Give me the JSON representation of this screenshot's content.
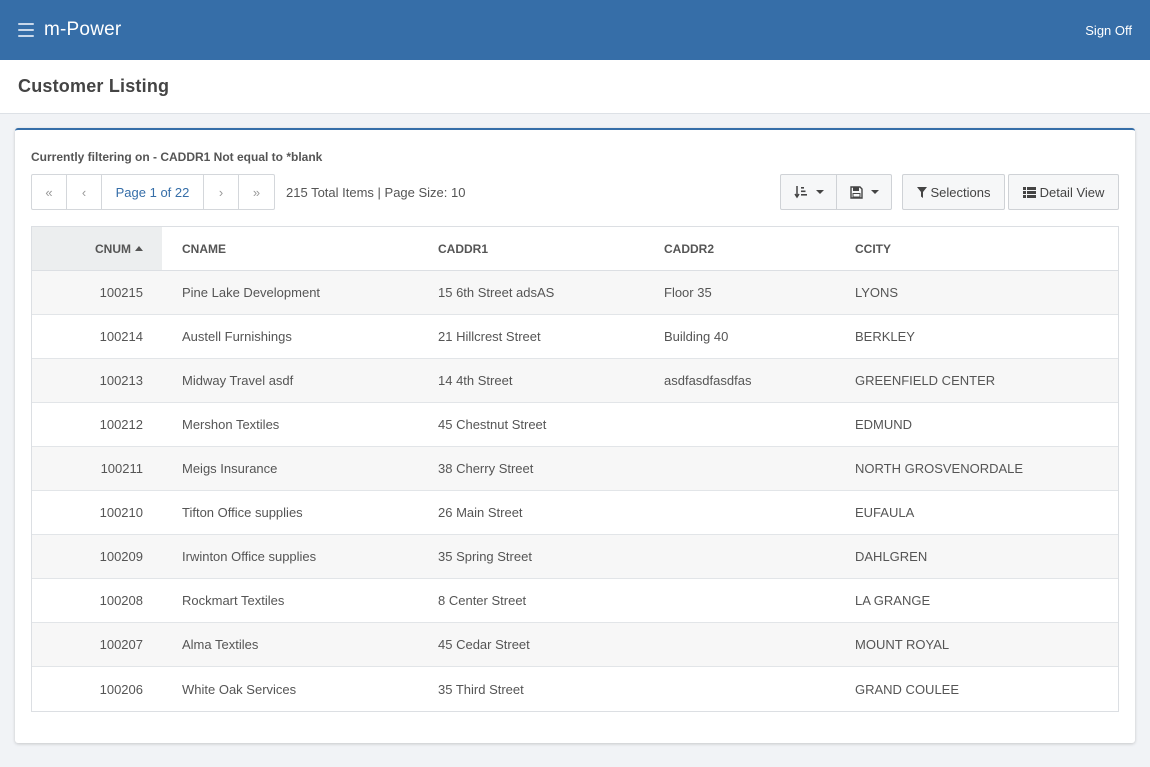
{
  "app": {
    "title": "m-Power",
    "sign_off": "Sign Off"
  },
  "page": {
    "title": "Customer Listing"
  },
  "filter_note": "Currently filtering on - CADDR1 Not equal to *blank",
  "pager": {
    "first": "«",
    "prev": "‹",
    "page_label": "Page 1 of 22",
    "next": "›",
    "last": "»"
  },
  "totals": "215 Total Items | Page Size: 10",
  "toolbar": {
    "selections_label": "Selections",
    "detail_view_label": "Detail View"
  },
  "icons": [
    "menu-icon",
    "sort-order-icon",
    "save-icon",
    "filter-icon",
    "list-icon",
    "caret-down-icon",
    "sort-asc-icon"
  ],
  "colors": {
    "accent": "#366ea8",
    "row_alt": "#f7f7f7",
    "header_sorted": "#eceeef"
  },
  "table": {
    "columns": [
      "CNUM",
      "CNAME",
      "CADDR1",
      "CADDR2",
      "CCITY"
    ],
    "rows": [
      {
        "cnum": "100215",
        "cname": "Pine Lake Development",
        "caddr1": "15 6th Street adsAS",
        "caddr2": "Floor 35",
        "ccity": "LYONS"
      },
      {
        "cnum": "100214",
        "cname": "Austell Furnishings",
        "caddr1": "21 Hillcrest Street",
        "caddr2": "Building 40",
        "ccity": "BERKLEY"
      },
      {
        "cnum": "100213",
        "cname": "Midway Travel asdf",
        "caddr1": "14 4th Street",
        "caddr2": "asdfasdfasdfas",
        "ccity": "GREENFIELD CENTER"
      },
      {
        "cnum": "100212",
        "cname": "Mershon Textiles",
        "caddr1": "45 Chestnut Street",
        "caddr2": "",
        "ccity": "EDMUND"
      },
      {
        "cnum": "100211",
        "cname": "Meigs Insurance",
        "caddr1": "38 Cherry Street",
        "caddr2": "",
        "ccity": "NORTH GROSVENORDALE"
      },
      {
        "cnum": "100210",
        "cname": "Tifton Office supplies",
        "caddr1": "26 Main Street",
        "caddr2": "",
        "ccity": "EUFAULA"
      },
      {
        "cnum": "100209",
        "cname": "Irwinton Office supplies",
        "caddr1": "35 Spring Street",
        "caddr2": "",
        "ccity": "DAHLGREN"
      },
      {
        "cnum": "100208",
        "cname": "Rockmart Textiles",
        "caddr1": "8 Center Street",
        "caddr2": "",
        "ccity": "LA GRANGE"
      },
      {
        "cnum": "100207",
        "cname": "Alma Textiles",
        "caddr1": "45 Cedar Street",
        "caddr2": "",
        "ccity": "MOUNT ROYAL"
      },
      {
        "cnum": "100206",
        "cname": "White Oak Services",
        "caddr1": "35 Third Street",
        "caddr2": "",
        "ccity": "GRAND COULEE"
      }
    ]
  }
}
